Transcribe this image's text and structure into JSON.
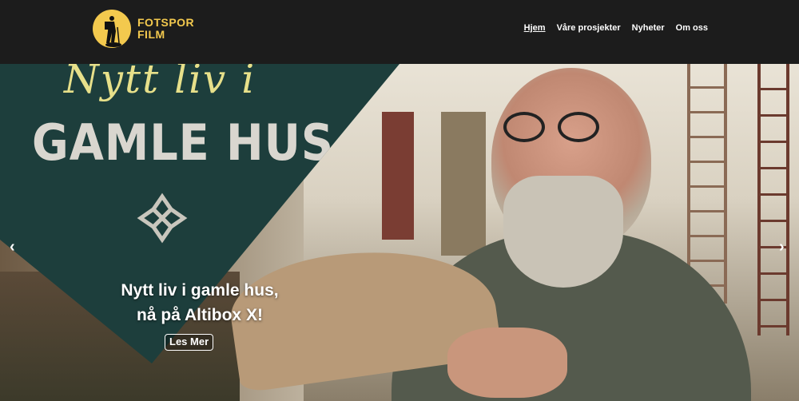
{
  "header": {
    "logo_line1": "FOTSPOR",
    "logo_line2": "FILM",
    "nav": [
      {
        "label": "Hjem",
        "active": true
      },
      {
        "label": "Våre prosjekter"
      },
      {
        "label": "Nyheter"
      },
      {
        "label": "Om oss"
      }
    ]
  },
  "hero": {
    "poster_script": "Nytt liv i",
    "poster_title": "GAMLE HUS",
    "caption_line1": "Nytt liv i gamle hus,",
    "caption_line2": "nå på Altibox X!",
    "button": "Les Mer",
    "prev_icon": "‹",
    "next_icon": "›"
  },
  "colors": {
    "brand": "#f3c94e",
    "teal": "#1d3e3c",
    "header_bg": "#1c1c1c"
  }
}
